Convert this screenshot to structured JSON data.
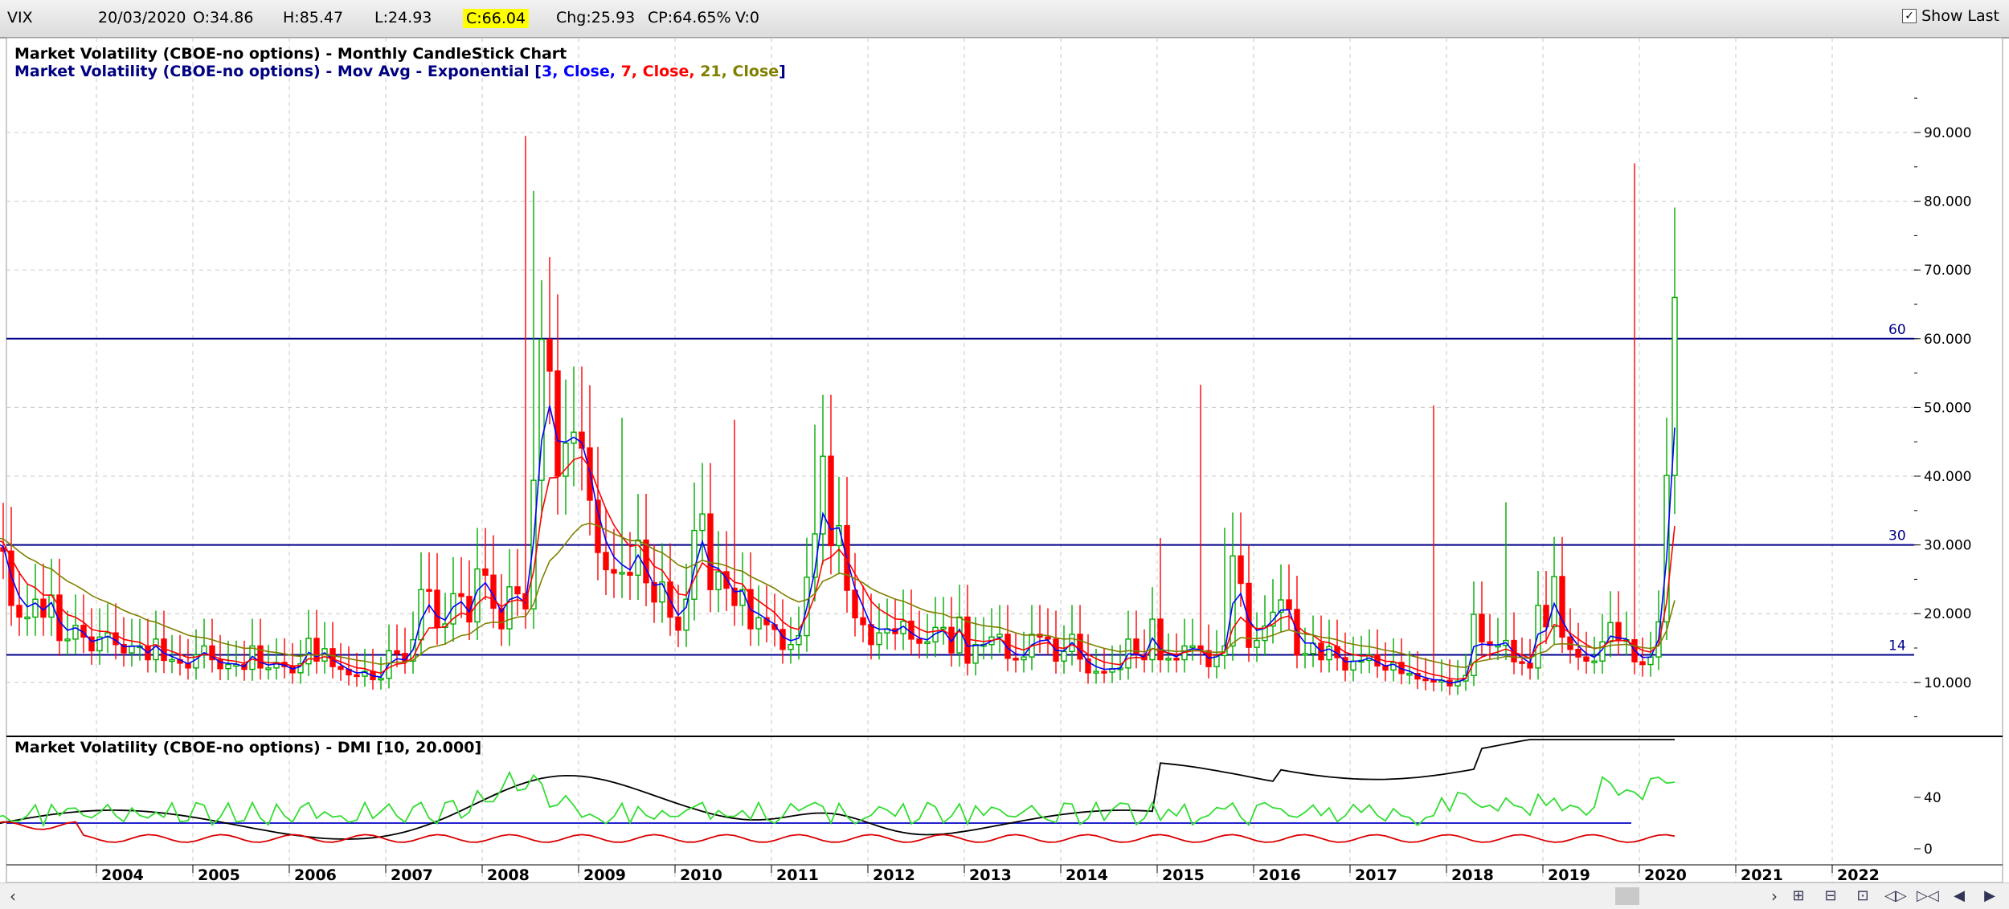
{
  "quote_bar": {
    "symbol": "VIX",
    "date": "20/03/2020",
    "open": "O:34.86",
    "high": "H:85.47",
    "low": "L:24.93",
    "close": "C:66.04",
    "change": "Chg:25.93",
    "change_pct": "CP:64.65%",
    "volume": "V:0",
    "show_last_label": "Show Last",
    "show_last_checked": true
  },
  "price_pane": {
    "title": "Market Volatility (CBOE-no options) - Monthly CandleStick Chart",
    "ma_prefix": "Market Volatility (CBOE-no options) - Mov Avg - Exponential [",
    "ma_params": [
      {
        "text": "3, Close,",
        "color": "#0000ff"
      },
      {
        "text": "7, Close,",
        "color": "#ff0000"
      },
      {
        "text": "21, Close",
        "color": "#808000"
      }
    ],
    "ma_suffix": "]",
    "y_ticks": [
      "90.000",
      "80.000",
      "70.000",
      "60.000",
      "50.000",
      "40.000",
      "30.000",
      "20.000",
      "10.000"
    ],
    "hlines": [
      {
        "label": "60",
        "value": 60
      },
      {
        "label": "30",
        "value": 30
      },
      {
        "label": "14",
        "value": 14
      }
    ]
  },
  "dmi_pane": {
    "title": "Market Volatility (CBOE-no options) - DMI [10, 20.000]",
    "y_ticks": [
      "40",
      "0"
    ]
  },
  "x_axis": {
    "years": [
      "2004",
      "2005",
      "2006",
      "2007",
      "2008",
      "2009",
      "2010",
      "2011",
      "2012",
      "2013",
      "2014",
      "2015",
      "2016",
      "2017",
      "2018",
      "2019",
      "2020",
      "2021",
      "2022"
    ]
  },
  "colors": {
    "up": "#00aa00",
    "down": "#ff0000",
    "ema3": "#0000ff",
    "ema7": "#ff0000",
    "ema21": "#808000",
    "hline": "#00008b",
    "adx": "#000000",
    "di_plus": "#33dd33",
    "di_minus": "#dd0000"
  },
  "chart_data": {
    "type": "candlestick",
    "interval": "monthly",
    "ylim": [
      0,
      100
    ],
    "start": "2003-01",
    "closes": [
      31.2,
      29.6,
      29.1,
      21.2,
      19.5,
      19.5,
      22.1,
      19.5,
      22.7,
      16.1,
      16.3,
      18.3,
      16.6,
      14.6,
      16.6,
      17.2,
      15.5,
      14.3,
      15.3,
      15.3,
      13.3,
      16.3,
      13.2,
      13.3,
      12.8,
      12.1,
      14.0,
      15.3,
      13.3,
      12.0,
      12.6,
      12.6,
      11.9,
      15.3,
      12.1,
      12.1,
      12.9,
      12.3,
      11.4,
      12.7,
      16.4,
      13.1,
      14.9,
      12.3,
      11.9,
      11.1,
      10.9,
      11.6,
      10.4,
      10.6,
      14.6,
      14.2,
      13.1,
      16.2,
      23.5,
      23.4,
      18.0,
      18.5,
      22.9,
      22.5,
      18.8,
      26.5,
      25.6,
      20.8,
      17.8,
      23.9,
      22.9,
      20.7,
      39.4,
      59.9,
      55.3,
      40.0,
      44.8,
      46.4,
      44.1,
      36.5,
      28.9,
      26.4,
      25.9,
      26.0,
      25.6,
      30.7,
      24.5,
      21.7,
      24.6,
      19.5,
      17.6,
      22.1,
      32.1,
      34.5,
      23.5,
      26.1,
      23.7,
      21.2,
      23.5,
      17.8,
      19.4,
      18.4,
      17.7,
      14.8,
      15.5,
      16.8,
      25.3,
      31.6,
      42.9,
      29.9,
      32.8,
      23.4,
      19.4,
      18.4,
      15.5,
      17.2,
      17.8,
      17.1,
      18.9,
      16.3,
      15.7,
      15.9,
      18.0,
      18.0,
      14.3,
      19.5,
      12.8,
      15.5,
      15.5,
      16.6,
      17.0,
      13.5,
      13.3,
      13.7,
      17.0,
      16.6,
      16.3,
      13.1,
      14.5,
      17.0,
      13.4,
      11.4,
      11.6,
      11.5,
      12.0,
      12.1,
      16.3,
      14.0,
      13.3,
      19.2,
      13.3,
      13.5,
      13.3,
      15.3,
      15.3,
      14.6,
      12.3,
      13.9,
      15.3,
      28.4,
      24.4,
      15.1,
      16.1,
      18.2,
      20.2,
      22.0,
      20.6,
      14.0,
      14.2,
      15.7,
      13.3,
      15.2,
      13.6,
      11.8,
      13.1,
      13.2,
      14.0,
      12.4,
      11.8,
      12.9,
      11.3,
      11.3,
      10.5,
      10.3,
      10.1,
      10.3,
      9.5,
      10.2,
      11.0,
      19.9,
      15.9,
      15.4,
      15.4,
      16.1,
      13.0,
      12.8,
      12.1,
      21.2,
      18.1,
      25.4,
      16.6,
      14.8,
      13.7,
      13.1,
      13.1,
      15.9,
      18.7,
      16.2,
      16.2,
      13.0,
      12.6,
      13.7,
      18.8,
      40.1,
      66.0
    ],
    "ema3_last": 47.0,
    "ema7_last": 36.0,
    "ema21_last": 22.0
  }
}
